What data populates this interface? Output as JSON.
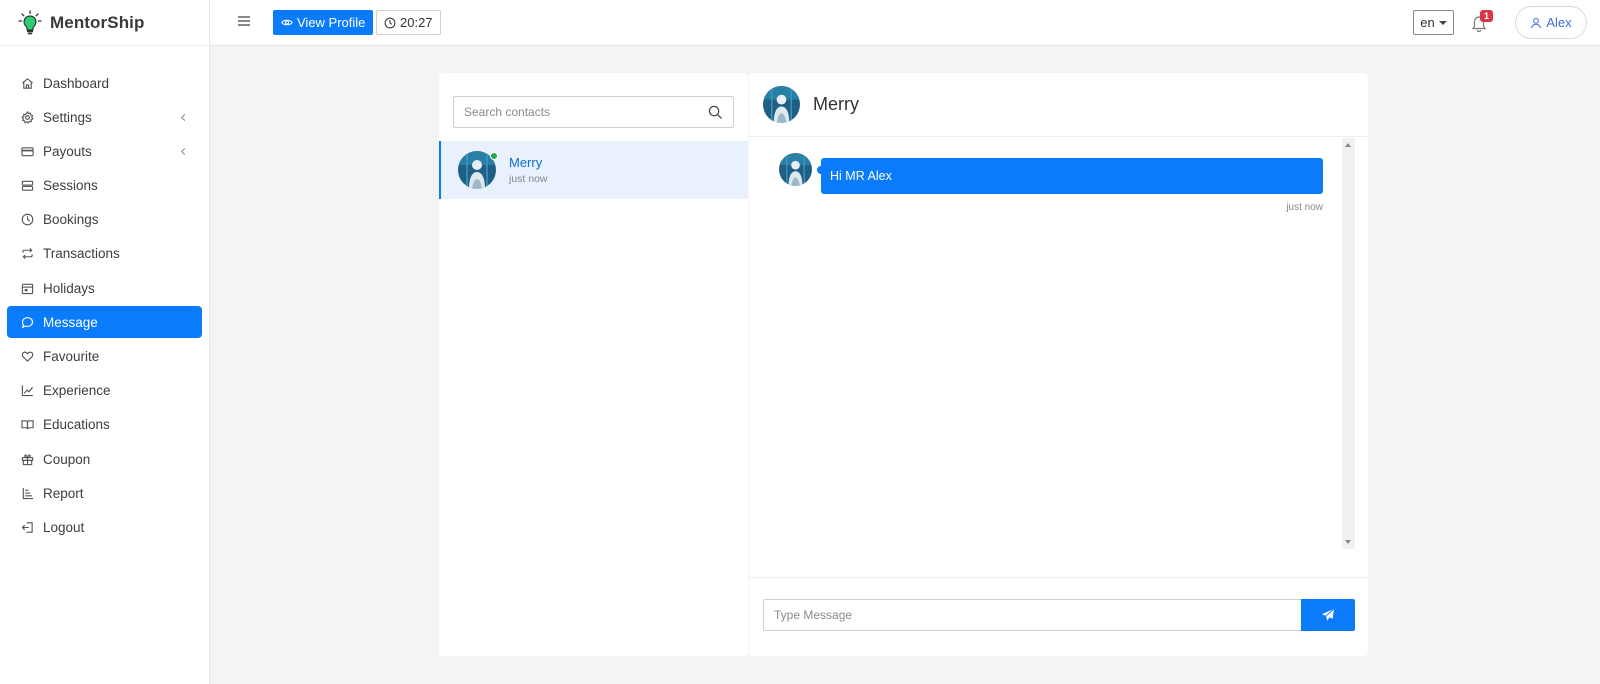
{
  "brand": {
    "name": "MentorShip"
  },
  "sidebar": {
    "items": [
      {
        "label": "Dashboard",
        "icon": "home-icon"
      },
      {
        "label": "Settings",
        "icon": "gear-icon",
        "submenu": true
      },
      {
        "label": "Payouts",
        "icon": "card-icon",
        "submenu": true
      },
      {
        "label": "Sessions",
        "icon": "sessions-icon"
      },
      {
        "label": "Bookings",
        "icon": "clock-icon"
      },
      {
        "label": "Transactions",
        "icon": "repeat-icon"
      },
      {
        "label": "Holidays",
        "icon": "calendar-icon"
      },
      {
        "label": "Message",
        "icon": "chat-icon",
        "active": true
      },
      {
        "label": "Favourite",
        "icon": "heart-icon"
      },
      {
        "label": "Experience",
        "icon": "chart-icon"
      },
      {
        "label": "Educations",
        "icon": "book-icon"
      },
      {
        "label": "Coupon",
        "icon": "gift-icon"
      },
      {
        "label": "Report",
        "icon": "report-icon"
      },
      {
        "label": "Logout",
        "icon": "logout-icon"
      }
    ]
  },
  "header": {
    "view_profile_label": "View Profile",
    "time": "20:27",
    "language": "en",
    "notification_count": "1",
    "user_name": "Alex"
  },
  "contacts": {
    "search_placeholder": "Search contacts",
    "list": [
      {
        "name": "Merry",
        "last_seen": "just now",
        "online": true
      }
    ]
  },
  "chat": {
    "title": "Merry",
    "messages": [
      {
        "text": "Hi MR Alex",
        "time": "just now"
      }
    ],
    "input_placeholder": "Type Message"
  },
  "colors": {
    "primary": "#0a7cfb",
    "active_contact_bg": "#e8f1fd",
    "online": "#28a745",
    "badge": "#dc3545"
  }
}
